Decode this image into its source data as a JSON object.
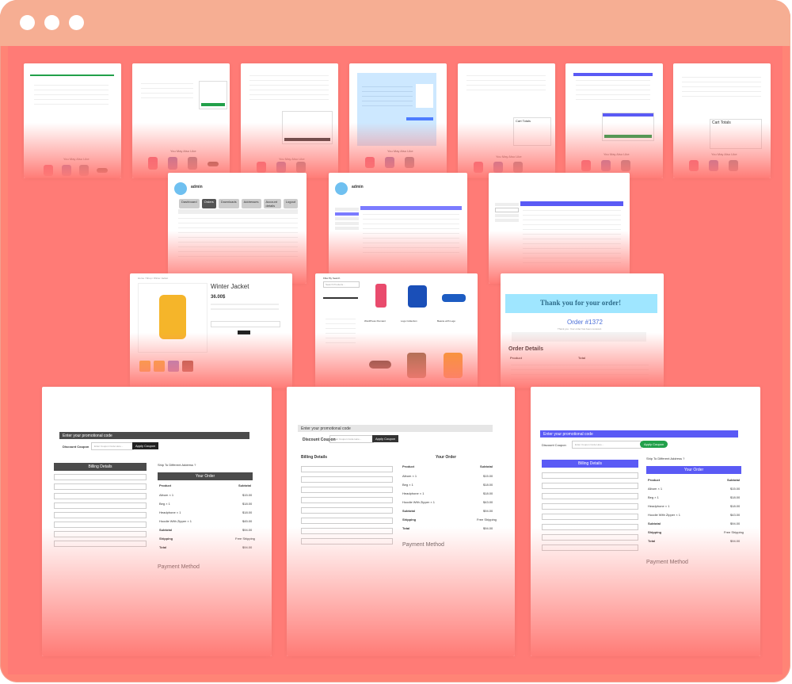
{
  "window": {
    "dots": [
      "",
      "",
      ""
    ]
  },
  "cards": {
    "cart1": {
      "section_title": "You May Also Like"
    },
    "cart2": {
      "section_title": "You May Also Like"
    },
    "cart3": {
      "section_title": "You May Also Like"
    },
    "cart4": {
      "section_title": "You May Also Like"
    },
    "cart5": {
      "section_title": "You May Also Like",
      "panel_title": "Cart Totals"
    },
    "cart6": {
      "section_title": "You May Also Like"
    },
    "cart7": {
      "section_title": "You May Also Like",
      "panel_title": "Cart Totals"
    },
    "account1": {
      "user": "admin",
      "tabs": [
        "Dashboard",
        "Orders",
        "Downloads",
        "Addresses",
        "Account details",
        "Logout"
      ]
    },
    "account2": {
      "user": "admin"
    },
    "account3": {
      "header": [
        "Order",
        "Date",
        "Status",
        "Total",
        "Actions"
      ]
    },
    "product": {
      "title": "Winter Jacket",
      "price": "36.00$",
      "breadcrumb": "Home / Shop / Winter Jacket"
    },
    "shop": {
      "filter_title": "Filter By Search",
      "search_placeholder": "Search Products...",
      "products": [
        {
          "name": "WordPress Pennant"
        },
        {
          "name": "Logo Collection"
        },
        {
          "name": "Beanie with Logo"
        }
      ]
    },
    "thankyou": {
      "title": "Thank you for your order!",
      "order": "Order #1372",
      "note": "Thank you. Your order has been received.",
      "details": "Order Details",
      "table": {
        "headers": [
          "Product",
          "Total"
        ]
      }
    },
    "checkout1": {
      "promo": "Enter your promotional code",
      "discount_label": "Discount Coupon",
      "coupon_placeholder": "Enter Coupon Code Here...",
      "apply": "Apply Coupon",
      "billing": "Billing Details",
      "ship": "Ship To Different Address ?",
      "your_order": "Your Order",
      "product": "Product",
      "subtotal": "Subtotal",
      "items": [
        {
          "name": "Album  × 1",
          "price": "$15.00"
        },
        {
          "name": "Beg  × 1",
          "price": "$18.00"
        },
        {
          "name": "Headphone  × 1",
          "price": "$18.00"
        },
        {
          "name": "Hoodie With Zipper  × 1",
          "price": "$45.00"
        }
      ],
      "subtotal_row": {
        "label": "Subtotal",
        "value": "$94.00"
      },
      "shipping_row": {
        "label": "Shipping",
        "value": "Free Shipping"
      },
      "total_row": {
        "label": "Total",
        "value": "$94.00"
      },
      "payment": "Payment Method"
    },
    "checkout2": {
      "promo": "Enter your promotional code",
      "discount_label": "Discount Coupon",
      "coupon_placeholder": "Enter Coupon Code Here...",
      "apply": "Apply Coupon",
      "billing": "Billing Details",
      "your_order": "Your Order",
      "product": "Product",
      "subtotal": "Subtotal",
      "items": [
        {
          "name": "Album  × 1",
          "price": "$15.00"
        },
        {
          "name": "Beg  × 1",
          "price": "$18.00"
        },
        {
          "name": "Headphone  × 1",
          "price": "$18.00"
        },
        {
          "name": "Hoodie With Zipper  × 1",
          "price": "$43.00"
        }
      ],
      "subtotal_row": {
        "label": "Subtotal",
        "value": "$94.00"
      },
      "shipping_row": {
        "label": "Shipping",
        "value": "Free Shipping"
      },
      "total_row": {
        "label": "Total",
        "value": "$94.00"
      },
      "payment": "Payment Method"
    },
    "checkout3": {
      "promo": "Enter your promotional code",
      "discount_label": "Discount Coupon",
      "coupon_placeholder": "Enter Coupon Code Here...",
      "apply": "Apply Coupon",
      "billing": "Billing Details",
      "ship": "Ship To Different Address ?",
      "your_order": "Your Order",
      "product": "Product",
      "subtotal": "Subtotal",
      "items": [
        {
          "name": "Album  × 1",
          "price": "$15.00"
        },
        {
          "name": "Beg  × 1",
          "price": "$18.00"
        },
        {
          "name": "Headphone  × 1",
          "price": "$18.00"
        },
        {
          "name": "Hoodie With Zipper  × 1",
          "price": "$43.00"
        }
      ],
      "subtotal_row": {
        "label": "Subtotal",
        "value": "$94.00"
      },
      "shipping_row": {
        "label": "Shipping",
        "value": "Free Shipping"
      },
      "total_row": {
        "label": "Total",
        "value": "$94.00"
      },
      "payment": "Payment Method"
    }
  },
  "colors": {
    "frame": "#f6ae93",
    "canvas": "#ff7b76",
    "accent_blue": "#5a5af5",
    "accent_green": "#22a04a",
    "accent_dark": "#4b4b4b",
    "thankyou_bg": "#9fe6ff"
  }
}
